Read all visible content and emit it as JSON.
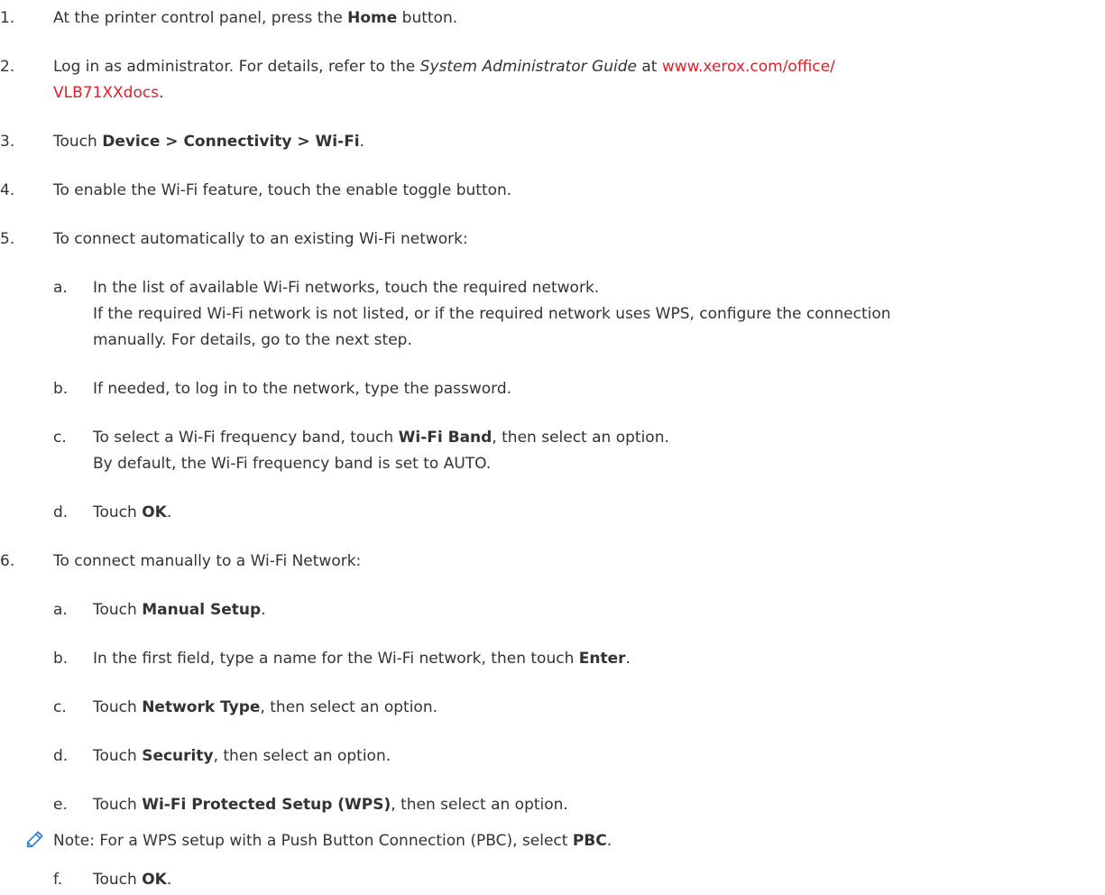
{
  "steps": {
    "s1": {
      "num": "1.",
      "pre": "At the printer control panel, press the ",
      "b1": "Home",
      "post": " button."
    },
    "s2": {
      "num": "2.",
      "pre": "Log in as administrator. For details, refer to the ",
      "it": "System Administrator Guide",
      "mid": " at ",
      "link1": "www.xerox.com/office/",
      "link2": "VLB71XXdocs",
      "end": "."
    },
    "s3": {
      "num": "3.",
      "pre": "Touch ",
      "b1": "Device > Connectivity > Wi-Fi",
      "end": "."
    },
    "s4": {
      "num": "4.",
      "text": "To enable the Wi-Fi feature, touch the enable toggle button."
    },
    "s5": {
      "num": "5.",
      "text": "To connect automatically to an existing Wi-Fi network:"
    },
    "s5a": {
      "num": "a.",
      "text": "In the list of available Wi-Fi networks, touch the required network.",
      "line2": "If the required Wi-Fi network is not listed, or if the required network uses WPS, configure the connection",
      "line3": "manually. For details, go to the next step."
    },
    "s5b": {
      "num": "b.",
      "text": "If needed, to log in to the network, type the password."
    },
    "s5c": {
      "num": "c.",
      "pre": "To select a Wi-Fi frequency band, touch ",
      "b1": "Wi-Fi Band",
      "post": ", then select an option.",
      "line2": "By default, the Wi-Fi frequency band is set to AUTO."
    },
    "s5d": {
      "num": "d.",
      "pre": "Touch ",
      "b1": "OK",
      "end": "."
    },
    "s6": {
      "num": "6.",
      "text": "To connect manually to a Wi-Fi Network:"
    },
    "s6a": {
      "num": "a.",
      "pre": "Touch ",
      "b1": "Manual Setup",
      "end": "."
    },
    "s6b": {
      "num": "b.",
      "pre": "In the first field, type a name for the Wi-Fi network, then touch ",
      "b1": "Enter",
      "end": "."
    },
    "s6c": {
      "num": "c.",
      "pre": "Touch ",
      "b1": "Network Type",
      "post": ", then select an option."
    },
    "s6d": {
      "num": "d.",
      "pre": "Touch ",
      "b1": "Security",
      "post": ", then select an option."
    },
    "s6e": {
      "num": "e.",
      "pre": "Touch ",
      "b1": "Wi-Fi Protected Setup (WPS)",
      "post": ", then select an option."
    },
    "note": {
      "pre": "Note: For a WPS setup with a Push Button Connection (PBC), select ",
      "b1": "PBC",
      "end": "."
    },
    "s6f": {
      "num": "f.",
      "pre": "Touch ",
      "b1": "OK",
      "end": "."
    }
  },
  "icons": {
    "note": "pencil-icon"
  },
  "colors": {
    "text": "#333333",
    "link": "#e02028",
    "icon": "#2b7bd6"
  }
}
